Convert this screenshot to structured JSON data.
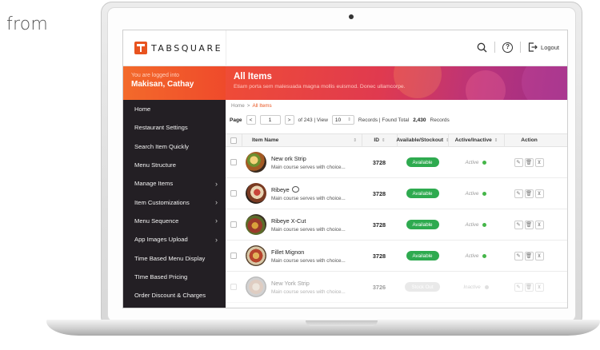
{
  "caption": "from",
  "app": {
    "logo_text": "TABSQUARE",
    "logout_label": "Logout",
    "help_glyph": "?"
  },
  "user": {
    "label": "You are logged into",
    "name": "Makisan, Cathay"
  },
  "sidebar": {
    "items": [
      {
        "label": "Home",
        "has_submenu": false
      },
      {
        "label": "Restaurant Settings",
        "has_submenu": false
      },
      {
        "label": "Search Item Quickly",
        "has_submenu": false
      },
      {
        "label": "Menu Structure",
        "has_submenu": false
      },
      {
        "label": "Manage Items",
        "has_submenu": true
      },
      {
        "label": "Item Customizations",
        "has_submenu": true
      },
      {
        "label": "Menu Sequence",
        "has_submenu": true
      },
      {
        "label": "App Images Upload",
        "has_submenu": true
      },
      {
        "label": "Time Based Menu Display",
        "has_submenu": false
      },
      {
        "label": "TIme Based Pricing",
        "has_submenu": false
      },
      {
        "label": "Order Discount & Charges",
        "has_submenu": false
      }
    ]
  },
  "banner": {
    "title": "All Items",
    "subtitle": "Etiam porta sem malesuada magna mollis euismod. Donec ullamcorpe."
  },
  "breadcrumb": {
    "home": "Home",
    "separator": ">",
    "current": "All Items"
  },
  "pager": {
    "page_label": "Page",
    "prev": "<",
    "page_value": "1",
    "next": ">",
    "of_text": "of 243 | View",
    "view_value": "10",
    "records_text": "Records | Found Total",
    "total": "2,430",
    "records_word": "Records"
  },
  "table": {
    "headers": {
      "name": "Item Name",
      "id": "ID",
      "available": "Available/Stockout",
      "active": "Active/Inactive",
      "action": "Action"
    },
    "rows": [
      {
        "name": "New ork Strip",
        "desc": "Main course serves with choice...",
        "id": "3728",
        "available": "Available",
        "active": "Active",
        "is_active": true,
        "faded": false,
        "chat": false
      },
      {
        "name": "Ribeye",
        "desc": "Main course serves with choice...",
        "id": "3728",
        "available": "Available",
        "active": "Active",
        "is_active": true,
        "faded": false,
        "chat": true
      },
      {
        "name": "Ribeye X-Cut",
        "desc": "Main course serves with choice...",
        "id": "3728",
        "available": "Available",
        "active": "Active",
        "is_active": true,
        "faded": false,
        "chat": false
      },
      {
        "name": "Fillet Mignon",
        "desc": "Main course serves with choice...",
        "id": "3728",
        "available": "Available",
        "active": "Active",
        "is_active": true,
        "faded": false,
        "chat": false
      },
      {
        "name": "New York Strip",
        "desc": "Main course serves with choice...",
        "id": "3726",
        "available": "Stock Out",
        "active": "Inactive",
        "is_active": false,
        "faded": true,
        "chat": false
      }
    ]
  },
  "colors": {
    "brand": "#e8531f",
    "sidebar_bg": "#231f24",
    "available": "#2eaa4f",
    "active_dot": "#45b649"
  }
}
